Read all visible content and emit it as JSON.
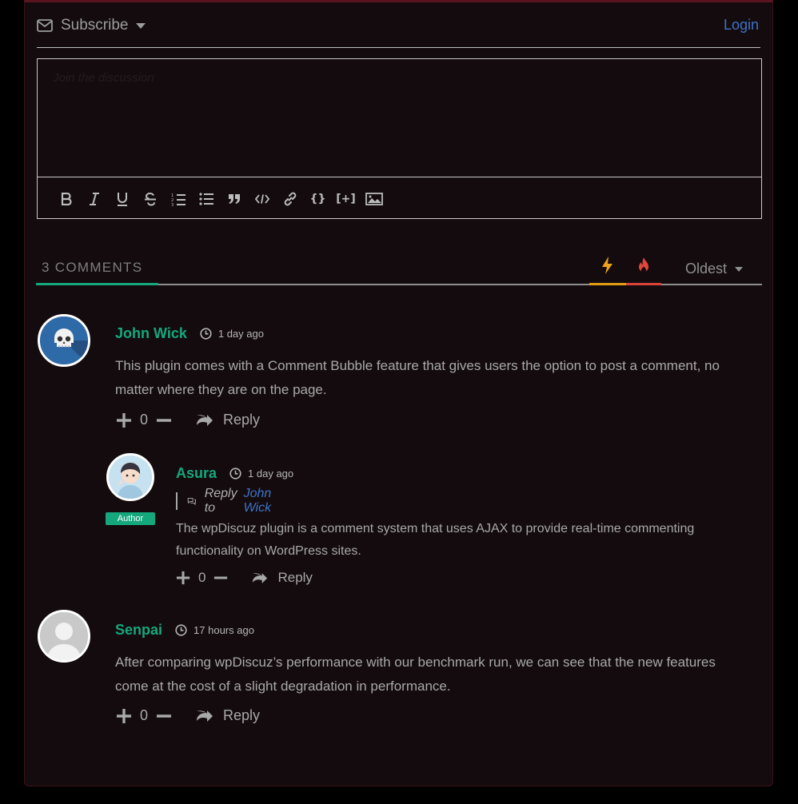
{
  "header": {
    "subscribe_label": "Subscribe",
    "login_label": "Login"
  },
  "editor": {
    "placeholder": "Join the discussion",
    "toolbar_icons": [
      "bold-icon",
      "italic-icon",
      "underline-icon",
      "strikethrough-icon",
      "ordered-list-icon",
      "unordered-list-icon",
      "blockquote-icon",
      "code-icon",
      "link-icon",
      "source-code-icon",
      "spoiler-icon",
      "image-icon"
    ]
  },
  "comments_header": {
    "count_label": "3 COMMENTS",
    "sort_hot_icon": "lightning-icon",
    "sort_trending_icon": "fire-icon",
    "sort_value": "Oldest"
  },
  "comments": [
    {
      "author": "John Wick",
      "time": "1 day ago",
      "text": "This plugin comes with a Comment Bubble feature that gives users the option to post a comment, no matter where they are on the page.",
      "votes": "0",
      "reply_label": "Reply",
      "avatar": "skull-avatar"
    },
    {
      "author": "Asura",
      "time": "1 day ago",
      "badge": "Author",
      "reply_to_label": "Reply to",
      "reply_to_name": "John Wick",
      "text": "The wpDiscuz plugin is a comment system that uses AJAX to provide real-time commenting functionality on WordPress sites.",
      "votes": "0",
      "reply_label": "Reply",
      "avatar": "anime-avatar"
    },
    {
      "author": "Senpai",
      "time": "17 hours ago",
      "text": "After comparing wpDiscuz’s performance with our benchmark run, we can see that the new features come at the cost of a slight degradation in performance.",
      "votes": "0",
      "reply_label": "Reply",
      "avatar": "default-avatar"
    }
  ],
  "colors": {
    "accent": "#14a87c",
    "link": "#3d74c8",
    "hot": "#e09d14",
    "fire": "#d8443a",
    "background": "#140b0e"
  }
}
